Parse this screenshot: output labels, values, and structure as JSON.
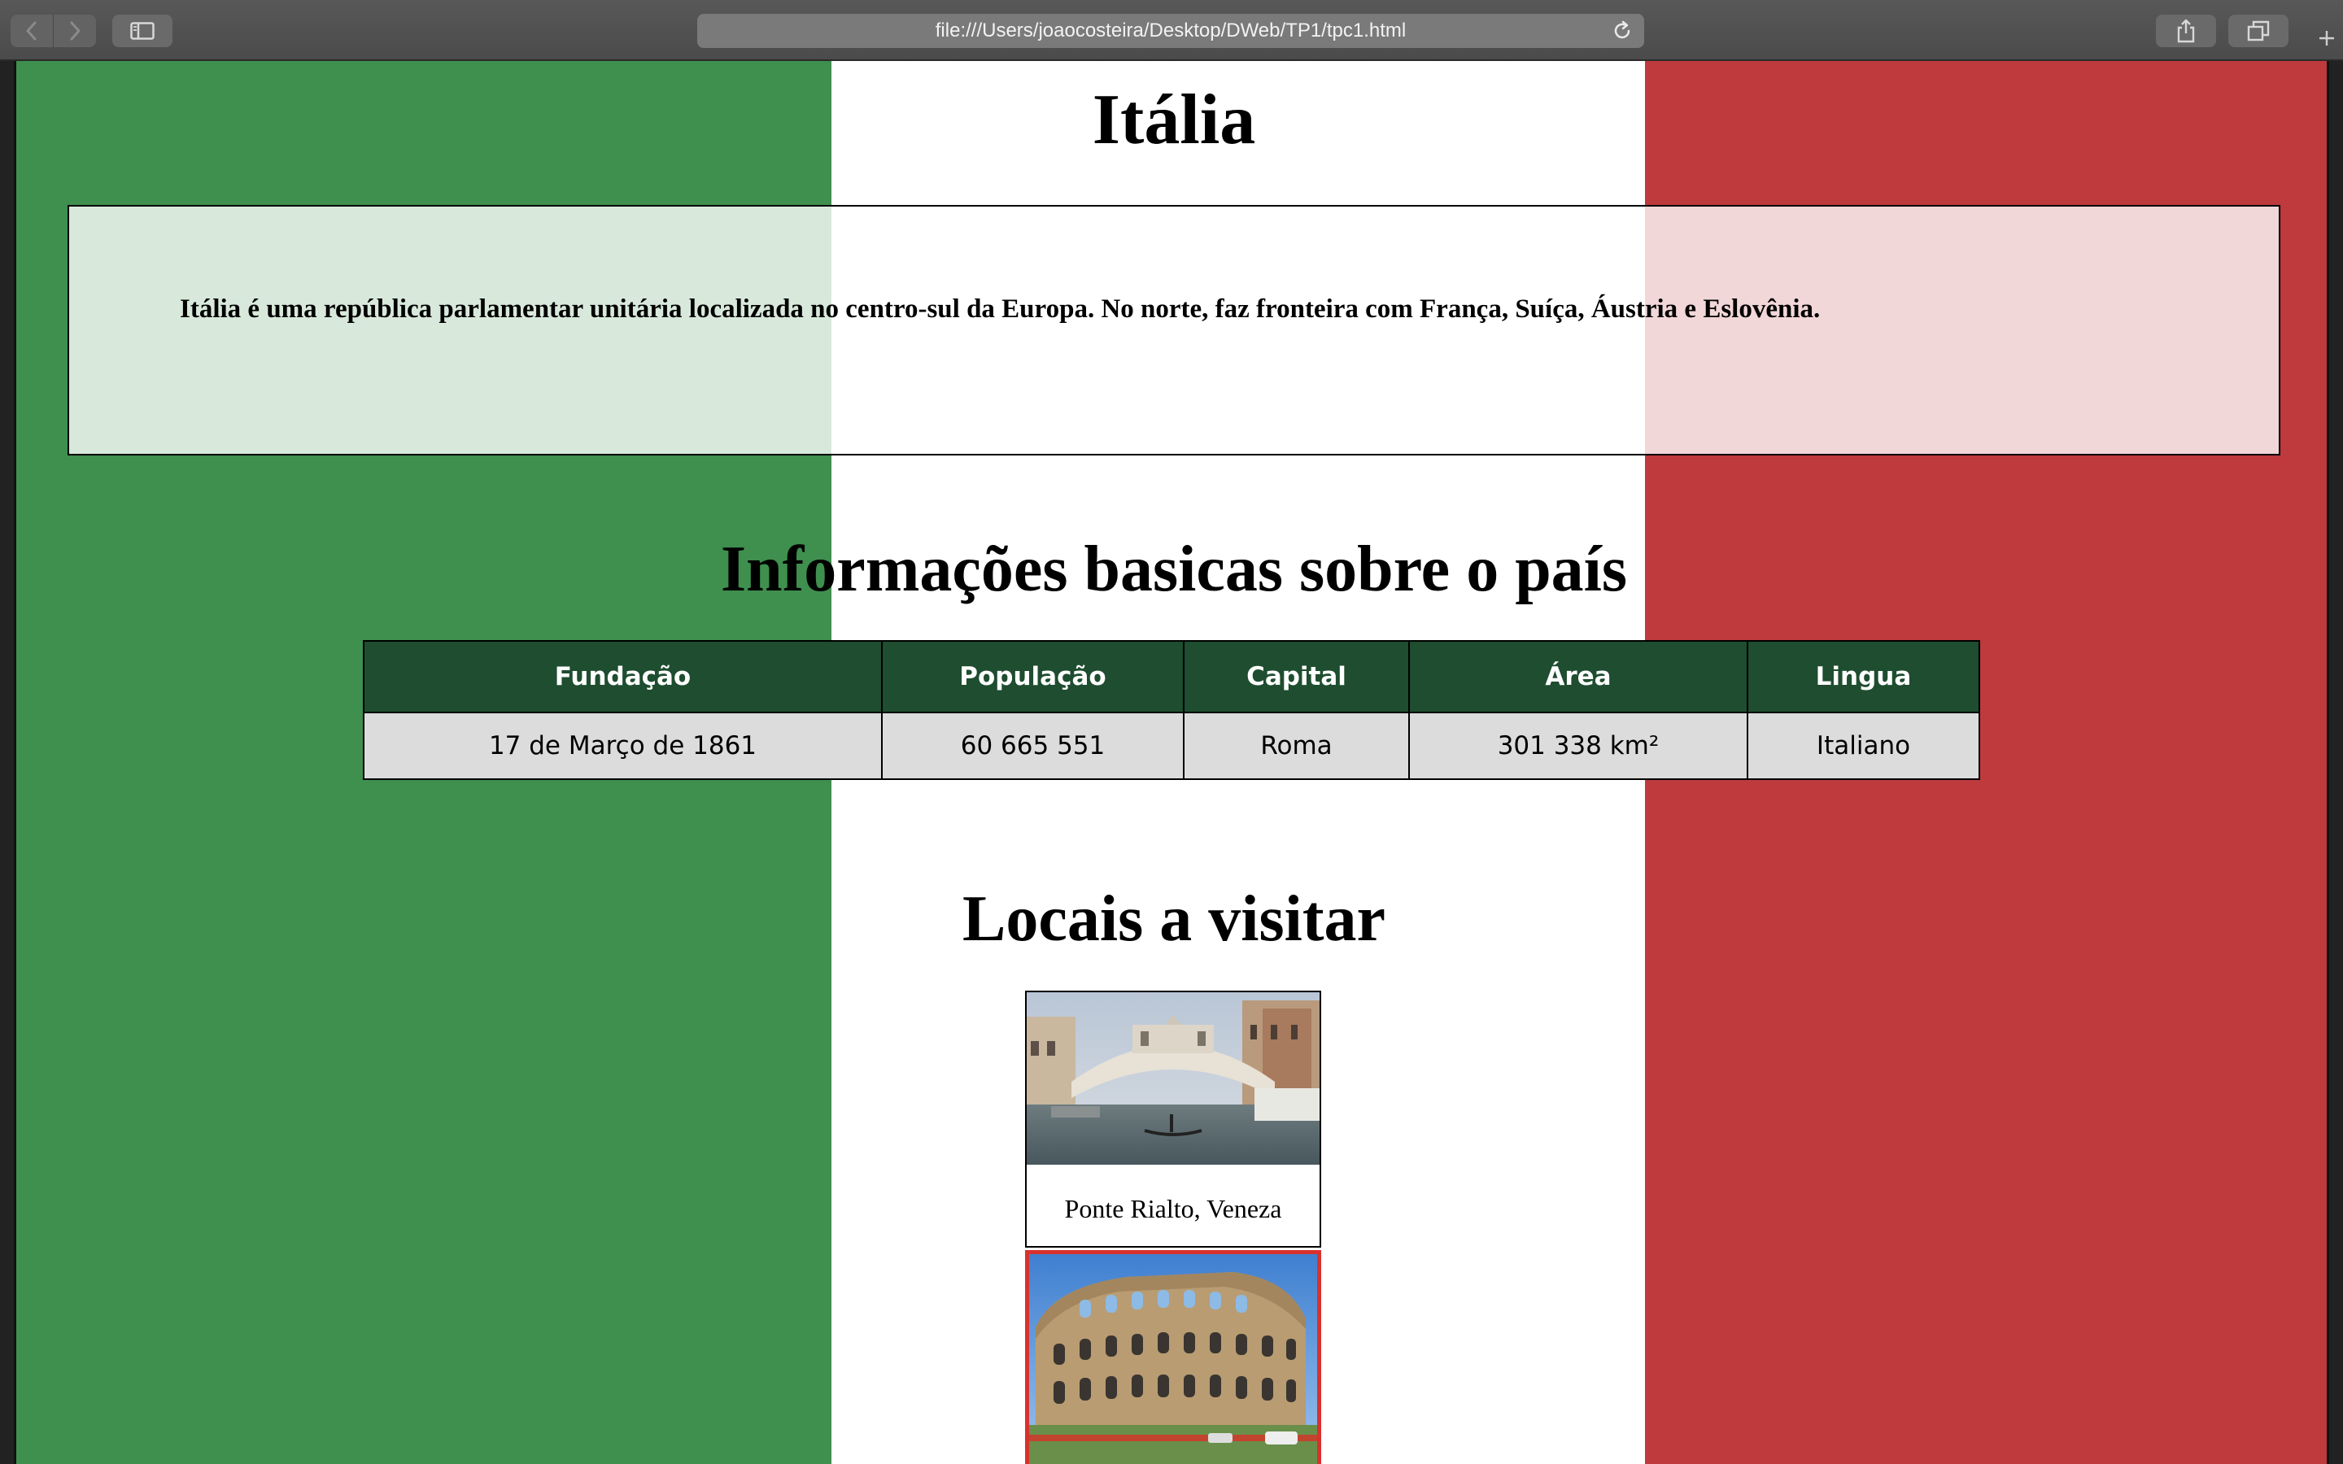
{
  "browser": {
    "url": "file:///Users/joaocosteira/Desktop/DWeb/TP1/tpc1.html"
  },
  "page": {
    "title": "Itália",
    "intro": "Itália é uma república parlamentar unitária localizada no centro-sul da Europa. No norte, faz fronteira com França, Suíça, Áustria e Eslovênia.",
    "info_heading": "Informações basicas sobre o país",
    "info_table": {
      "headers": [
        "Fundação",
        "População",
        "Capital",
        "Área",
        "Lingua"
      ],
      "values": [
        "17 de Março de 1861",
        "60 665 551",
        "Roma",
        "301 338 km²",
        "Italiano"
      ]
    },
    "visit_heading": "Locais a visitar",
    "places": [
      {
        "caption": "Ponte Rialto, Veneza",
        "image": "rialto-bridge-photo"
      },
      {
        "caption": "",
        "image": "colosseum-photo"
      }
    ]
  },
  "colors": {
    "flag_green": "#3f8f4e",
    "flag_white": "#ffffff",
    "flag_red": "#be3a3c",
    "table_header": "#1e4d2f",
    "table_cell": "#dcdcdc",
    "highlight_border": "#d8322e"
  }
}
